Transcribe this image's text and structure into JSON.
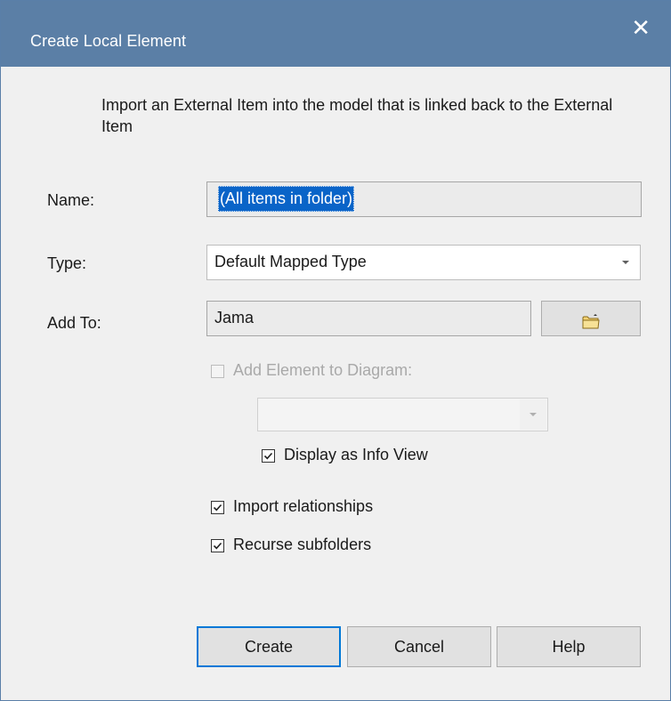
{
  "window": {
    "title": "Create Local Element",
    "close_glyph": "✕",
    "close_icon": "close-icon"
  },
  "description": "Import an External Item into the model that is linked back to the External Item",
  "form": {
    "name": {
      "label": "Name:",
      "value": "(All items in folder)"
    },
    "type": {
      "label": "Type:",
      "value": "Default Mapped Type"
    },
    "add_to": {
      "label": "Add To:",
      "value": "Jama",
      "browse_icon": "folder-icon"
    }
  },
  "options": {
    "add_to_diagram": {
      "label": "Add Element to Diagram:",
      "checked": false,
      "enabled": false
    },
    "diagram_select": {
      "value": "",
      "enabled": false
    },
    "display_info_view": {
      "label": "Display as Info View",
      "checked": true
    },
    "import_relationships": {
      "label": "Import relationships",
      "checked": true
    },
    "recurse_subfolders": {
      "label": "Recurse subfolders",
      "checked": true
    }
  },
  "buttons": {
    "create": "Create",
    "cancel": "Cancel",
    "help": "Help"
  },
  "colors": {
    "titlebar": "#5b7fa6",
    "selection": "#0a64c8",
    "default_button_border": "#0078d7"
  }
}
